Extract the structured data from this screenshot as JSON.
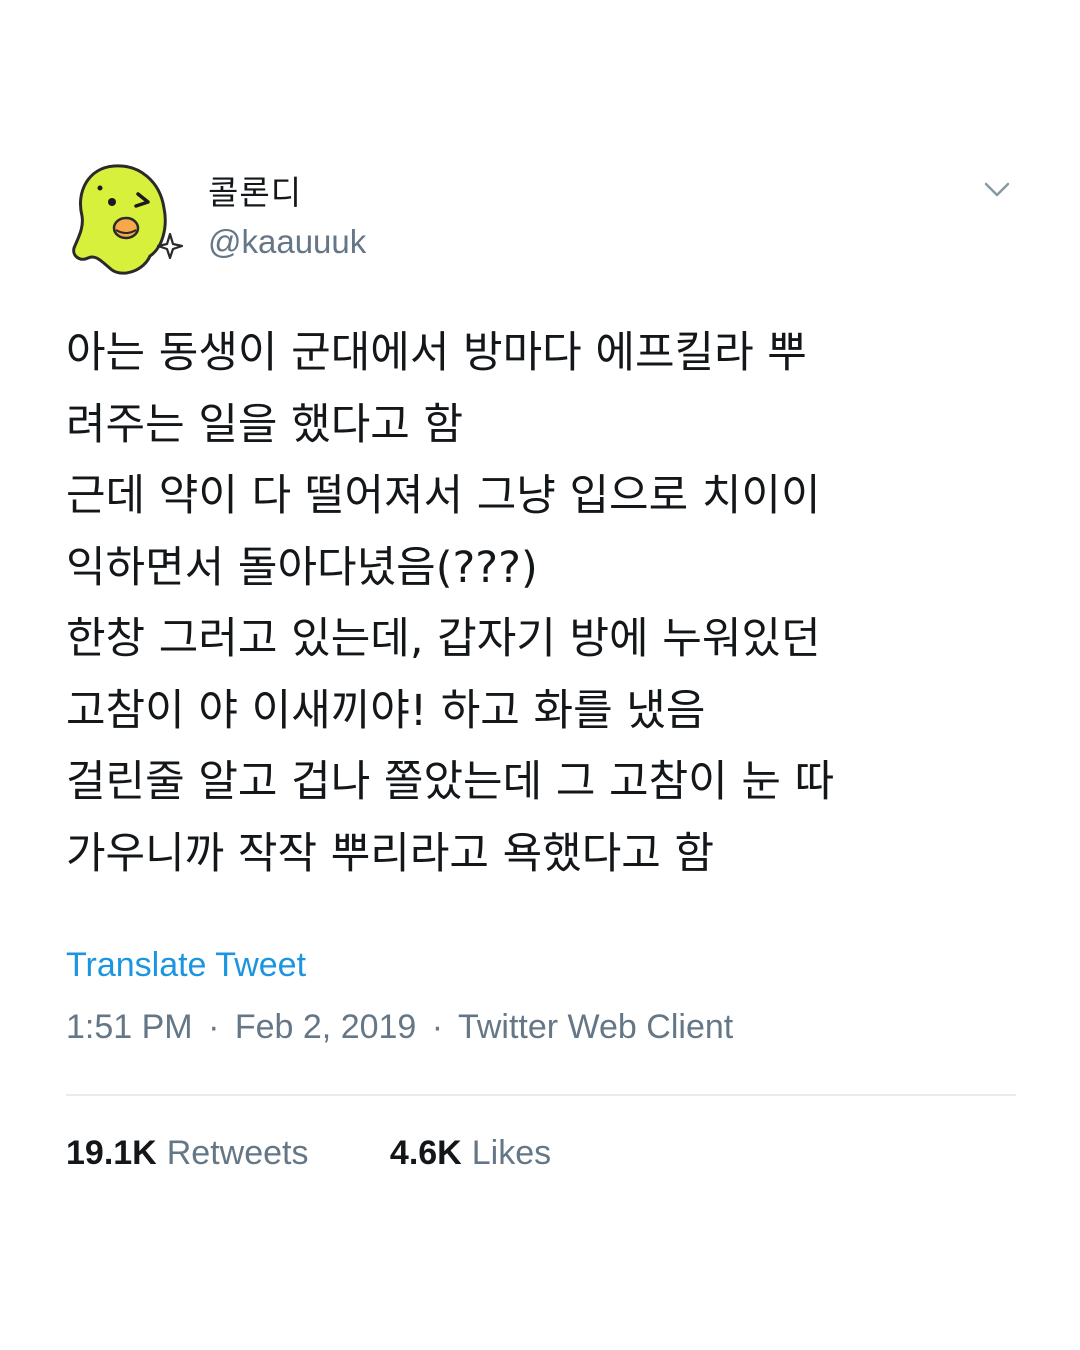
{
  "author": {
    "display_name": "콜론디",
    "handle": "@kaauuuk",
    "avatar_icon": "yellow-bird-character-icon"
  },
  "tweet": {
    "lines": [
      "아는 동생이 군대에서 방마다 에프킬라 뿌",
      "려주는 일을 했다고 함",
      "근데 약이 다 떨어져서 그냥 입으로 치이이",
      "익하면서 돌아다녔음(???)",
      "한창 그러고 있는데, 갑자기 방에 누워있던",
      "고참이 야 이새끼야! 하고 화를 냈음",
      "걸린줄 알고 겁나 쫄았는데 그 고참이 눈 따",
      "가우니까 작작 뿌리라고 욕했다고 함"
    ]
  },
  "translate_label": "Translate Tweet",
  "meta": {
    "time": "1:51 PM",
    "separator": "·",
    "date": "Feb 2, 2019",
    "client": "Twitter Web Client"
  },
  "stats": {
    "retweets_count": "19.1K",
    "retweets_label": "Retweets",
    "likes_count": "4.6K",
    "likes_label": "Likes"
  },
  "colors": {
    "link": "#1b95e0",
    "secondary_text": "#657786",
    "primary_text": "#14171a",
    "divider": "#e6ecf0",
    "avatar_yellow": "#d7f03c"
  }
}
